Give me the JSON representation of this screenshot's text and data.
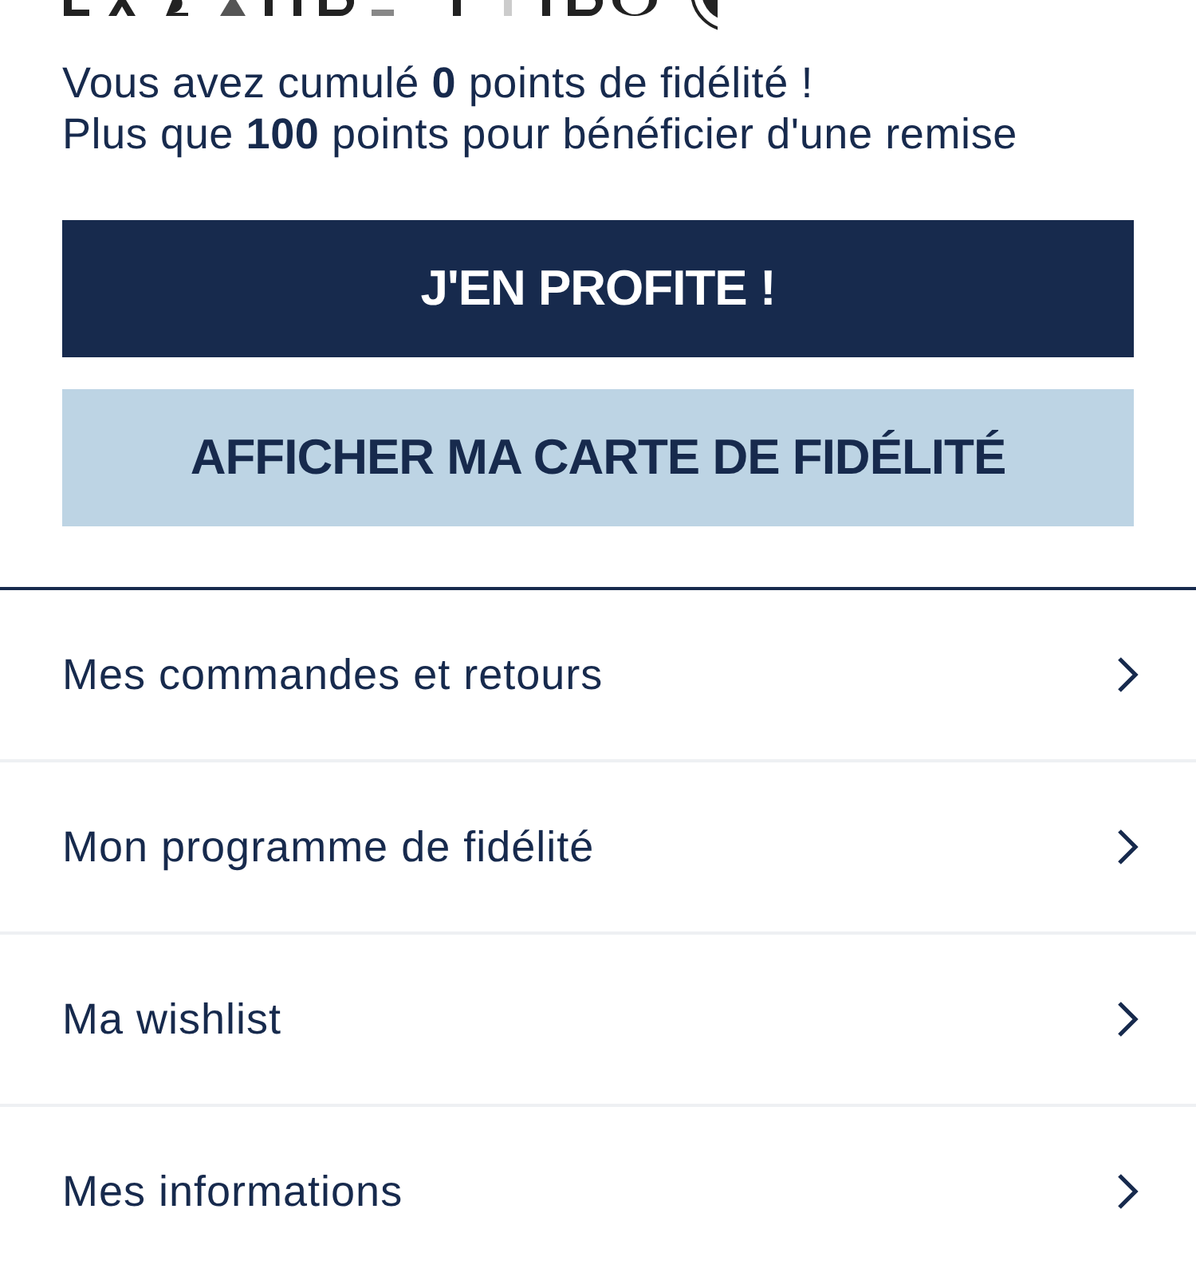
{
  "loyalty_message": [
    "Vous avez cumulé **0** points de fidélité !",
    "Plus que **100** points pour bénéficier d'une remise"
  ],
  "buttons": [
    {
      "label": "J'EN PROFITE !",
      "kind": "primary"
    },
    {
      "label": "AFFICHER MA CARTE DE FIDÉLITÉ",
      "kind": "secondary"
    }
  ],
  "menu_items": [
    {
      "label": "Mes commandes et retours"
    },
    {
      "label": "Mon programme de fidélité"
    },
    {
      "label": "Ma wishlist"
    },
    {
      "label": "Mes informations"
    }
  ]
}
